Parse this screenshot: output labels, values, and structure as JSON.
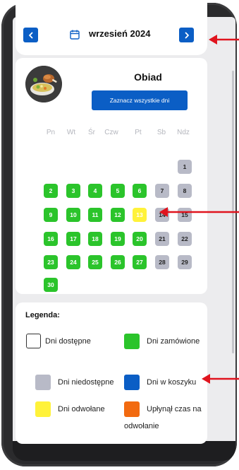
{
  "header": {
    "month": "wrzesień 2024",
    "prev_icon": "chevron-left-icon",
    "next_icon": "chevron-right-icon",
    "calendar_icon": "calendar-icon"
  },
  "meal": {
    "title": "Obiad",
    "select_all_label": "Zaznacz wszystkie dni"
  },
  "weekdays": [
    "Pn",
    "Wt",
    "Śr",
    "Czw",
    "Pt",
    "Sb",
    "Ndz"
  ],
  "days": [
    {
      "n": "1",
      "state": "unavailable"
    },
    {
      "n": "2",
      "state": "ordered"
    },
    {
      "n": "3",
      "state": "ordered"
    },
    {
      "n": "4",
      "state": "ordered"
    },
    {
      "n": "5",
      "state": "ordered"
    },
    {
      "n": "6",
      "state": "ordered"
    },
    {
      "n": "7",
      "state": "unavailable"
    },
    {
      "n": "8",
      "state": "unavailable"
    },
    {
      "n": "9",
      "state": "ordered"
    },
    {
      "n": "10",
      "state": "ordered"
    },
    {
      "n": "11",
      "state": "ordered"
    },
    {
      "n": "12",
      "state": "ordered"
    },
    {
      "n": "13",
      "state": "cancelled"
    },
    {
      "n": "14",
      "state": "unavailable"
    },
    {
      "n": "15",
      "state": "unavailable"
    },
    {
      "n": "16",
      "state": "ordered"
    },
    {
      "n": "17",
      "state": "ordered"
    },
    {
      "n": "18",
      "state": "ordered"
    },
    {
      "n": "19",
      "state": "ordered"
    },
    {
      "n": "20",
      "state": "ordered"
    },
    {
      "n": "21",
      "state": "unavailable"
    },
    {
      "n": "22",
      "state": "unavailable"
    },
    {
      "n": "23",
      "state": "ordered"
    },
    {
      "n": "24",
      "state": "ordered"
    },
    {
      "n": "25",
      "state": "ordered"
    },
    {
      "n": "26",
      "state": "ordered"
    },
    {
      "n": "27",
      "state": "ordered"
    },
    {
      "n": "28",
      "state": "unavailable"
    },
    {
      "n": "29",
      "state": "unavailable"
    },
    {
      "n": "30",
      "state": "ordered"
    }
  ],
  "legend": {
    "title": "Legenda:",
    "items": [
      {
        "label": "Dni dostępne",
        "color": "#ffffff"
      },
      {
        "label": "Dni zamówione",
        "color": "#2bc42b"
      },
      {
        "label": "Dni niedostępne",
        "color": "#b8bac7"
      },
      {
        "label": "Dni w koszyku",
        "color": "#0b5ec5"
      },
      {
        "label": "Dni odwołane",
        "color": "#fff23a"
      },
      {
        "label": "Upłynął czas na odwołanie",
        "color": "#f26a10"
      }
    ]
  },
  "colors": {
    "accent": "#0b5ec5",
    "ordered": "#2bc42b",
    "unavailable": "#b8bac7",
    "cancelled": "#fff23a",
    "expired": "#f26a10",
    "annotation": "#e0141e"
  }
}
